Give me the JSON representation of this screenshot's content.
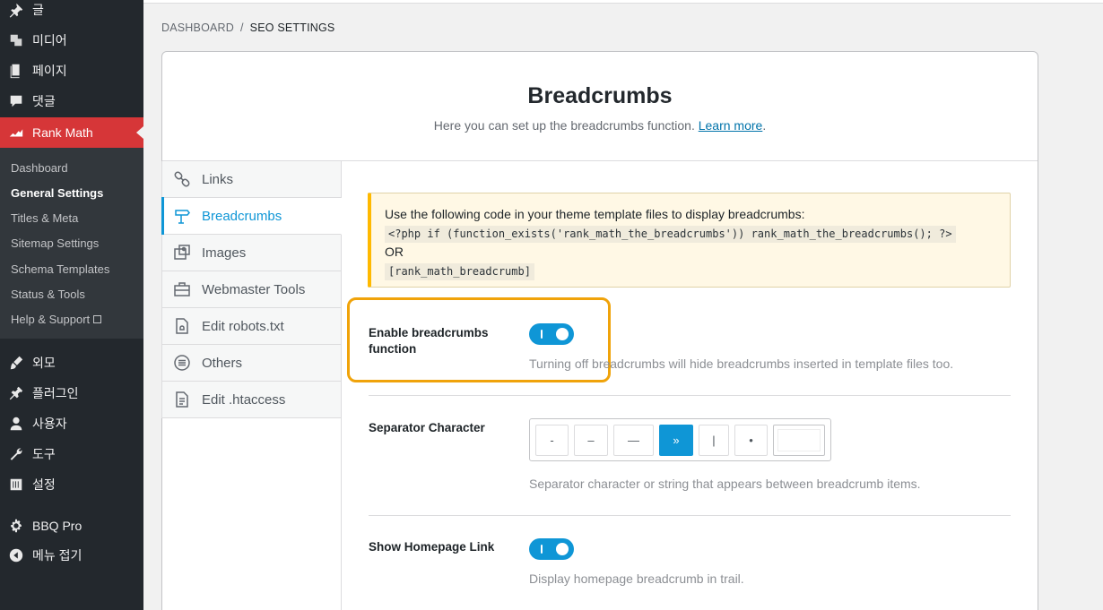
{
  "sidebar": {
    "top_items": [
      {
        "label": "글",
        "icon": "pin-icon"
      },
      {
        "label": "미디어",
        "icon": "media-icon"
      },
      {
        "label": "페이지",
        "icon": "page-icon"
      },
      {
        "label": "댓글",
        "icon": "comment-icon"
      },
      {
        "label": "Rank Math",
        "icon": "rank-math-icon"
      }
    ],
    "submenu": [
      "Dashboard",
      "General Settings",
      "Titles & Meta",
      "Sitemap Settings",
      "Schema Templates",
      "Status & Tools",
      "Help & Support"
    ],
    "bottom_items": [
      {
        "label": "외모",
        "icon": "brush-icon"
      },
      {
        "label": "플러그인",
        "icon": "plugin-icon"
      },
      {
        "label": "사용자",
        "icon": "user-icon"
      },
      {
        "label": "도구",
        "icon": "wrench-icon"
      },
      {
        "label": "설정",
        "icon": "settings-icon"
      },
      {
        "label": "BBQ Pro",
        "icon": "gear-icon"
      },
      {
        "label": "메뉴 접기",
        "icon": "collapse-icon"
      }
    ],
    "accent_color": "#d63638"
  },
  "breadcrumb": {
    "root": "DASHBOARD",
    "separator": "/",
    "current": "SEO SETTINGS"
  },
  "header": {
    "title": "Breadcrumbs",
    "subtitle": "Here you can set up the breadcrumbs function.",
    "learn_more": "Learn more",
    "period": "."
  },
  "tabs": [
    {
      "label": "Links",
      "icon": "link-icon"
    },
    {
      "label": "Breadcrumbs",
      "icon": "signpost-icon",
      "active": true
    },
    {
      "label": "Images",
      "icon": "images-icon"
    },
    {
      "label": "Webmaster Tools",
      "icon": "toolbox-icon"
    },
    {
      "label": "Edit robots.txt",
      "icon": "robots-file-icon"
    },
    {
      "label": "Others",
      "icon": "list-circle-icon"
    },
    {
      "label": "Edit .htaccess",
      "icon": "htaccess-file-icon"
    }
  ],
  "notice": {
    "intro": "Use the following code in your theme template files to display breadcrumbs:",
    "php_code": "<?php if (function_exists('rank_math_the_breadcrumbs')) rank_math_the_breadcrumbs(); ?>",
    "or": "OR",
    "shortcode": "[rank_math_breadcrumb]"
  },
  "settings": {
    "enable": {
      "label": "Enable breadcrumbs function",
      "enabled": true,
      "description": "Turning off breadcrumbs will hide breadcrumbs inserted in template files too."
    },
    "separator": {
      "label": "Separator Character",
      "options": [
        "-",
        "–",
        "—",
        "»",
        "|",
        "•",
        ""
      ],
      "selected": "»",
      "description": "Separator character or string that appears between breadcrumb items."
    },
    "homepage": {
      "label": "Show Homepage Link",
      "enabled": true,
      "description": "Display homepage breadcrumb in trail."
    }
  },
  "colors": {
    "accent": "#0f96d6",
    "highlight": "#f0a30a",
    "notice_bg": "#fff8e5"
  }
}
